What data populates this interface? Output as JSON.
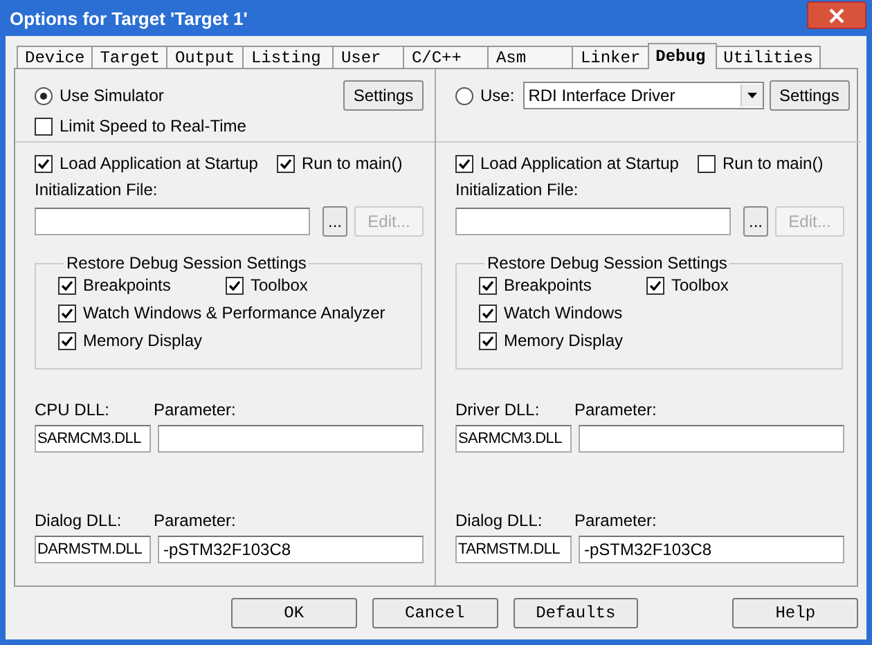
{
  "window": {
    "title": "Options for Target 'Target 1'"
  },
  "tabs": [
    {
      "label": "Device",
      "selected": false
    },
    {
      "label": "Target",
      "selected": false
    },
    {
      "label": "Output",
      "selected": false
    },
    {
      "label": "Listing",
      "selected": false
    },
    {
      "label": "User",
      "selected": false
    },
    {
      "label": "C/C++",
      "selected": false
    },
    {
      "label": "Asm",
      "selected": false
    },
    {
      "label": "Linker",
      "selected": false
    },
    {
      "label": "Debug",
      "selected": true
    },
    {
      "label": "Utilities",
      "selected": false
    }
  ],
  "panels": [
    {
      "target": {
        "label": "Use Simulator",
        "selected": true
      },
      "limit_speed": {
        "label": "Limit Speed to Real-Time",
        "checked": false
      },
      "settings_button": "Settings",
      "load_app": {
        "label": "Load Application at Startup",
        "checked": true
      },
      "run_to_main": {
        "label": "Run to main()",
        "checked": true
      },
      "init_file": {
        "label": "Initialization File:",
        "browse": "...",
        "edit": "Edit...",
        "edit_disabled": true
      },
      "restore": {
        "title": "Restore Debug Session Settings",
        "options": [
          {
            "label": "Breakpoints",
            "checked": true
          },
          {
            "label": "Toolbox",
            "checked": true
          },
          {
            "label": "Watch Windows & Performance Analyzer",
            "checked": true
          },
          {
            "label": "Memory Display",
            "checked": true
          }
        ]
      },
      "dlls": [
        {
          "label": "CPU DLL:",
          "value": "SARMCM3.DLL",
          "parameter_label": "Parameter:"
        },
        {
          "label": "Dialog DLL:",
          "value": "DARMSTM.DLL",
          "parameter_label": "Parameter:",
          "parameter": "-pSTM32F103C8"
        }
      ]
    },
    {
      "target": {
        "label": "Use:",
        "selected": false,
        "driver": "RDI Interface Driver"
      },
      "settings_button": "Settings",
      "load_app": {
        "label": "Load Application at Startup",
        "checked": true
      },
      "run_to_main": {
        "label": "Run to main()",
        "checked": false
      },
      "init_file": {
        "label": "Initialization File:",
        "browse": "...",
        "edit": "Edit...",
        "edit_disabled": true
      },
      "restore": {
        "title": "Restore Debug Session Settings",
        "options": [
          {
            "label": "Breakpoints",
            "checked": true
          },
          {
            "label": "Toolbox",
            "checked": true
          },
          {
            "label": "Watch Windows",
            "checked": true
          },
          {
            "label": "Memory Display",
            "checked": true
          }
        ]
      },
      "dlls": [
        {
          "label": "Driver DLL:",
          "value": "SARMCM3.DLL",
          "parameter_label": "Parameter:"
        },
        {
          "label": "Dialog DLL:",
          "value": "TARMSTM.DLL",
          "parameter_label": "Parameter:",
          "parameter": "-pSTM32F103C8"
        }
      ]
    }
  ],
  "buttons": [
    {
      "label": "OK"
    },
    {
      "label": "Cancel"
    },
    {
      "label": "Defaults"
    },
    {
      "label": "Help"
    }
  ]
}
